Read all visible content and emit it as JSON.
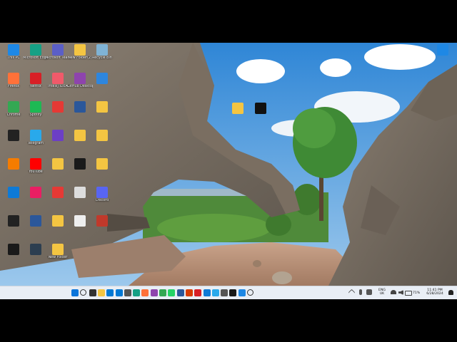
{
  "desktop": {
    "icons": [
      {
        "label": "This PC",
        "icon": "monitor-icon",
        "color": "#1e88e5"
      },
      {
        "label": "Microsoft Edge",
        "icon": "edge-icon",
        "color": "#16a085"
      },
      {
        "label": "Microsoft Teams",
        "icon": "teams-icon",
        "color": "#5b5fc7"
      },
      {
        "label": "New Folder(2)",
        "icon": "folder-icon",
        "color": "#f4c542"
      },
      {
        "label": "Recycle Bin",
        "icon": "recycle-bin-icon",
        "color": "#7fb3d5"
      },
      {
        "label": "Firefox",
        "icon": "firefox-icon",
        "color": "#ff7139"
      },
      {
        "label": "Netflix",
        "icon": "netflix-icon",
        "color": "#d81f26"
      },
      {
        "label": "IntelliJ IDEA",
        "icon": "intellij-icon",
        "color": "#f05a6a"
      },
      {
        "label": "GitHub Desktop",
        "icon": "github-icon",
        "color": "#8e44ad"
      },
      {
        "label": "",
        "icon": "network-icon",
        "color": "#2e86de"
      },
      {
        "label": "Chrome",
        "icon": "chrome-icon",
        "color": "#34a853"
      },
      {
        "label": "Spotify",
        "icon": "spotify-icon",
        "color": "#1db954"
      },
      {
        "label": "",
        "icon": "pdf-file-icon",
        "color": "#e53935"
      },
      {
        "label": "",
        "icon": "word-file-icon",
        "color": "#2b579a"
      },
      {
        "label": "",
        "icon": "folder-icon",
        "color": "#f4c542"
      },
      {
        "label": "",
        "icon": "capcut-icon",
        "color": "#222222"
      },
      {
        "label": "Telegram",
        "icon": "telegram-icon",
        "color": "#29a9eb"
      },
      {
        "label": "",
        "icon": "visual-studio-icon",
        "color": "#6c3fc5"
      },
      {
        "label": "",
        "icon": "folder-icon",
        "color": "#f4c542"
      },
      {
        "label": "",
        "icon": "folder-icon",
        "color": "#f4c542"
      },
      {
        "label": "",
        "icon": "vlc-icon",
        "color": "#f57c00"
      },
      {
        "label": "YouTube",
        "icon": "youtube-icon",
        "color": "#ff0000"
      },
      {
        "label": "",
        "icon": "folder-icon",
        "color": "#f4c542"
      },
      {
        "label": "",
        "icon": "jetbrains-icon",
        "color": "#1a1a1a"
      },
      {
        "label": "",
        "icon": "folder-icon",
        "color": "#f4c542"
      },
      {
        "label": "",
        "icon": "vs-code-icon",
        "color": "#0e7ad6"
      },
      {
        "label": "",
        "icon": "apps-icon",
        "color": "#e91e63"
      },
      {
        "label": "",
        "icon": "pdf-file-icon",
        "color": "#e53935"
      },
      {
        "label": "",
        "icon": "share-icon",
        "color": "#dddddd"
      },
      {
        "label": "Discord",
        "icon": "discord-icon",
        "color": "#5865f2"
      },
      {
        "label": "",
        "icon": "file-icon",
        "color": "#222222"
      },
      {
        "label": "",
        "icon": "word-file-icon",
        "color": "#2b579a"
      },
      {
        "label": "",
        "icon": "folder-icon",
        "color": "#f4c542"
      },
      {
        "label": "",
        "icon": "file-icon",
        "color": "#eeeeee"
      },
      {
        "label": "",
        "icon": "app-icon",
        "color": "#c0392b"
      },
      {
        "label": "",
        "icon": "valorant-icon",
        "color": "#1a1a1a"
      },
      {
        "label": "",
        "icon": "app-icon",
        "color": "#2c3e50"
      },
      {
        "label": "New Folder",
        "icon": "folder-icon",
        "color": "#f4c542"
      }
    ],
    "floating_icons": [
      {
        "label": "",
        "icon": "folder-icon",
        "color": "#f4c542"
      },
      {
        "label": "",
        "icon": "stock-chart-icon",
        "color": "#111111"
      }
    ],
    "corner_icon": {
      "label": "",
      "icon": "photo-icon",
      "color": "#1e88e5"
    }
  },
  "taskbar": {
    "apps": [
      {
        "icon": "windows-start-icon",
        "color": "#0a74da"
      },
      {
        "icon": "search-icon",
        "color": "#333333"
      },
      {
        "icon": "task-view-icon",
        "color": "#333333"
      },
      {
        "icon": "file-explorer-icon",
        "color": "#f4c542"
      },
      {
        "icon": "store-icon",
        "color": "#0078d4"
      },
      {
        "icon": "defender-icon",
        "color": "#0078d4"
      },
      {
        "icon": "settings-icon",
        "color": "#555555"
      },
      {
        "icon": "edge-icon",
        "color": "#16a085"
      },
      {
        "icon": "firefox-icon",
        "color": "#ff7139"
      },
      {
        "icon": "copilot-icon",
        "color": "#8e44ad"
      },
      {
        "icon": "chrome-icon",
        "color": "#34a853"
      },
      {
        "icon": "whatsapp-icon",
        "color": "#25d366"
      },
      {
        "icon": "word-icon",
        "color": "#2b579a"
      },
      {
        "icon": "office-icon",
        "color": "#d83b01"
      },
      {
        "icon": "netflix-icon",
        "color": "#d81f26"
      },
      {
        "icon": "vs-code-icon",
        "color": "#0e7ad6"
      },
      {
        "icon": "telegram-icon",
        "color": "#29a9eb"
      },
      {
        "icon": "text-icon",
        "color": "#555555"
      },
      {
        "icon": "jetbrains-icon",
        "color": "#1a1a1a"
      },
      {
        "icon": "snipping-tool-icon",
        "color": "#1e88e5"
      },
      {
        "icon": "globe-icon",
        "color": "#333333"
      }
    ],
    "tray": {
      "lang_top": "ENG",
      "lang_bottom": "UK",
      "battery": "71%",
      "time": "11:41 PM",
      "date": "6/28/2024"
    }
  }
}
